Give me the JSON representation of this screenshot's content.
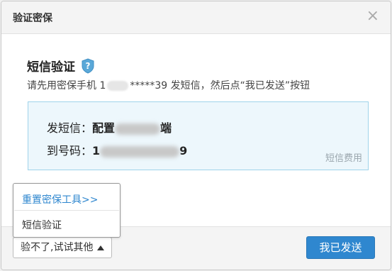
{
  "dialog": {
    "title": "验证密保",
    "close_glyph": "×"
  },
  "sms": {
    "heading": "短信验证",
    "shield_icon": "shield-question-icon",
    "instruction_prefix": "请先用密保手机 1",
    "instruction_suffix": "*****39 发短信，然后点“我已发送”按钮"
  },
  "info": {
    "send_label": "发短信：",
    "send_value_start": "配置",
    "send_value_end": "端",
    "to_label": "到号码：",
    "to_value_start": "1",
    "to_value_end": "9",
    "fee_link": "短信费用"
  },
  "dropdown": {
    "items": [
      "重置密保工具>>",
      "短信验证"
    ]
  },
  "footer": {
    "alt_button": "验不了,试试其他",
    "confirm_button": "我已发送"
  },
  "colors": {
    "accent": "#2f87cf",
    "info_bg": "#edf7fc",
    "info_border": "#9fd3ea"
  }
}
